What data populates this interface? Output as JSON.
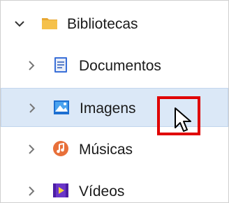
{
  "tree": {
    "root": {
      "label": "Bibliotecas",
      "icon": "folder-icon",
      "expanded": true
    },
    "items": [
      {
        "label": "Documentos",
        "icon": "document-icon",
        "expanded": false,
        "selected": false
      },
      {
        "label": "Imagens",
        "icon": "image-icon",
        "expanded": false,
        "selected": true
      },
      {
        "label": "Músicas",
        "icon": "music-icon",
        "expanded": false,
        "selected": false
      },
      {
        "label": "Vídeos",
        "icon": "video-icon",
        "expanded": false,
        "selected": false
      }
    ]
  },
  "colors": {
    "selection": "#dbe8f7",
    "highlight": "#e00000",
    "folder": "#f5c14b"
  },
  "overlay": {
    "cursor_icon": "mouse-pointer-icon",
    "highlight": "red-highlight-box"
  }
}
